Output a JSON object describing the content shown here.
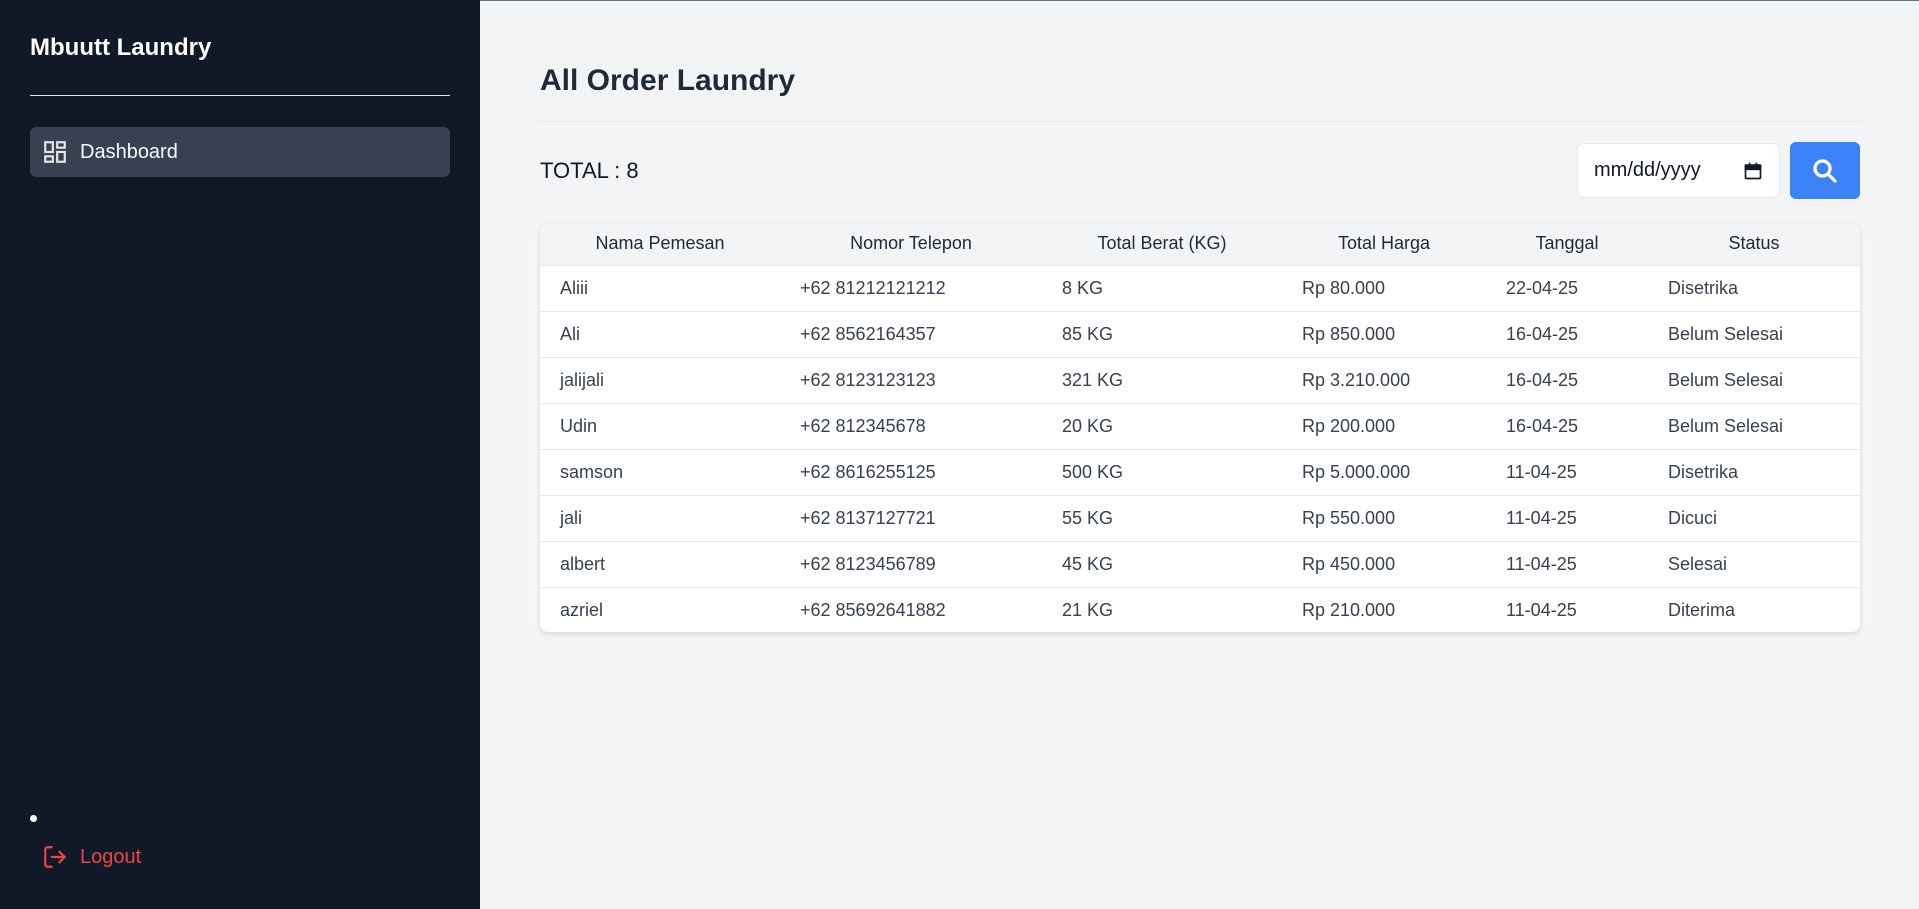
{
  "sidebar": {
    "brand": "Mbuutt Laundry",
    "nav_items": [
      {
        "label": "Dashboard",
        "icon": "dashboard-icon"
      }
    ],
    "logout_label": "Logout",
    "logout_icon": "logout-icon",
    "logout_color": "#ef4444"
  },
  "main": {
    "title": "All Order Laundry",
    "total_label": "TOTAL : 8",
    "date_filter": {
      "placeholder": "mm/dd/yyyy",
      "icon": "calendar-icon"
    },
    "search_button": {
      "icon": "search-icon",
      "color": "#3b82f6"
    },
    "table": {
      "columns": [
        "Nama Pemesan",
        "Nomor Telepon",
        "Total Berat (KG)",
        "Total Harga",
        "Tanggal",
        "Status"
      ],
      "rows": [
        [
          "Aliii",
          "+62 81212121212",
          "8 KG",
          "Rp 80.000",
          "22-04-25",
          "Disetrika"
        ],
        [
          "Ali",
          "+62 8562164357",
          "85 KG",
          "Rp 850.000",
          "16-04-25",
          "Belum Selesai"
        ],
        [
          "jalijali",
          "+62 8123123123",
          "321 KG",
          "Rp 3.210.000",
          "16-04-25",
          "Belum Selesai"
        ],
        [
          "Udin",
          "+62 812345678",
          "20 KG",
          "Rp 200.000",
          "16-04-25",
          "Belum Selesai"
        ],
        [
          "samson",
          "+62 8616255125",
          "500 KG",
          "Rp 5.000.000",
          "11-04-25",
          "Disetrika"
        ],
        [
          "jali",
          "+62 8137127721",
          "55 KG",
          "Rp 550.000",
          "11-04-25",
          "Dicuci"
        ],
        [
          "albert",
          "+62 8123456789",
          "45 KG",
          "Rp 450.000",
          "11-04-25",
          "Selesai"
        ],
        [
          "azriel",
          "+62 85692641882",
          "21 KG",
          "Rp 210.000",
          "11-04-25",
          "Diterima"
        ]
      ]
    }
  }
}
